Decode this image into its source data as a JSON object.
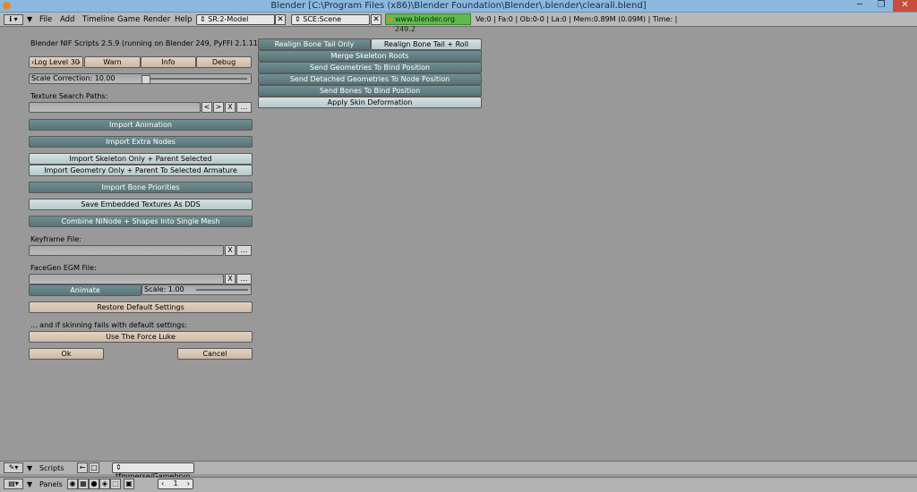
{
  "window": {
    "title": "Blender [C:\\Program Files (x86)\\Blender Foundation\\Blender\\.blender\\clearall.blend]"
  },
  "menubar": {
    "menus": [
      "File",
      "Add",
      "Timeline",
      "Game",
      "Render",
      "Help"
    ],
    "screen": "SR:2-Model",
    "scene": "SCE:Scene",
    "url": "www.blender.org 249.2",
    "stats": "Ve:0 | Fa:0 | Ob:0-0 | La:0  | Mem:0.89M (0.09M)  | Time: |"
  },
  "panel": {
    "header": "Blender NIF Scripts 2.5.9 (running on Blender 249, PyFFI 2.1.11)",
    "log_level": "Log Level 30",
    "log_buttons": [
      "Warn",
      "Info",
      "Debug"
    ],
    "scale_correction": "Scale Correction:  10.00",
    "texture_paths_label": "Texture Search Paths:",
    "path_buttons": [
      "<",
      ">",
      "X",
      "..."
    ],
    "import_animation": "Import Animation",
    "import_extra_nodes": "Import Extra Nodes",
    "import_skeleton": "Import Skeleton Only + Parent Selected",
    "import_geometry": "Import Geometry Only + Parent To Selected Armature",
    "import_bone_priorities": "Import Bone Priorities",
    "save_textures": "Save Embedded Textures As DDS",
    "combine": "Combine NiNode + Shapes Into Single Mesh",
    "keyframe_label": "Keyframe File:",
    "facegen_label": "FaceGen EGM File:",
    "file_x": "X",
    "file_browse": "...",
    "animate": "Animate",
    "scale": "Scale:  1.00",
    "restore": "Restore Default Settings",
    "skin_note": "... and if skinning fails with default settings:",
    "force": "Use The Force Luke",
    "ok": "Ok",
    "cancel": "Cancel"
  },
  "right": {
    "realign_tail": "Realign Bone Tail Only",
    "realign_roll": "Realign Bone Tail + Roll",
    "merge": "Merge Skeleton Roots",
    "send_geom": "Send Geometries To Bind Position",
    "send_detached": "Send Detached Geometries To Node Position",
    "send_bones": "Send Bones To Bind Position",
    "apply_skin": "Apply Skin Deformation"
  },
  "bottom": {
    "scripts": "Scripts",
    "path": "tfmmerse/Gamebryo",
    "panels": "Panels",
    "page": "1"
  }
}
